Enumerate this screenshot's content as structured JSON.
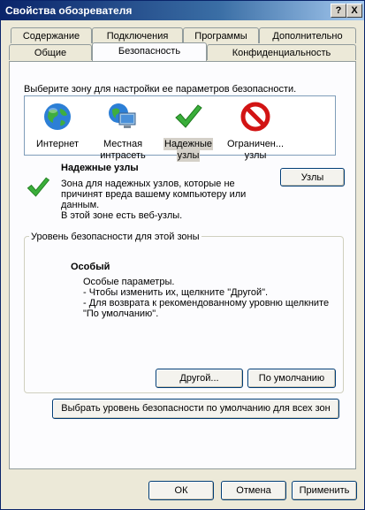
{
  "window": {
    "title": "Свойства обозревателя",
    "help_btn": "?",
    "close_btn": "X"
  },
  "tabs_row1": [
    {
      "label": "Содержание"
    },
    {
      "label": "Подключения"
    },
    {
      "label": "Программы"
    },
    {
      "label": "Дополнительно"
    }
  ],
  "tabs_row2": [
    {
      "label": "Общие"
    },
    {
      "label": "Безопасность",
      "selected": true
    },
    {
      "label": "Конфиденциальность"
    }
  ],
  "zones": {
    "prompt": "Выберите зону для настройки ее параметров безопасности.",
    "items": [
      {
        "label1": "Интернет",
        "label2": "",
        "icon": "globe-icon"
      },
      {
        "label1": "Местная",
        "label2": "интрасеть",
        "icon": "intranet-icon"
      },
      {
        "label1": "Надежные",
        "label2": "узлы",
        "icon": "checkmark-icon",
        "selected": true
      },
      {
        "label1": "Ограничен...",
        "label2": "узлы",
        "icon": "restricted-icon"
      }
    ]
  },
  "zone_info": {
    "title": "Надежные узлы",
    "desc1": "Зона для надежных узлов, которые не",
    "desc2": "причинят вреда вашему компьютеру или",
    "desc3": "данным.",
    "desc4": "В этой зоне есть веб-узлы.",
    "sites_btn": "Узлы"
  },
  "security_level": {
    "legend": "Уровень безопасности для этой зоны",
    "name": "Особый",
    "line1": "Особые параметры.",
    "line2": "- Чтобы изменить их, щелкните \"Другой\".",
    "line3": "- Для возврата к рекомендованному уровню щелкните",
    "line4": "\"По умолчанию\".",
    "custom_btn": "Другой...",
    "default_btn": "По умолчанию"
  },
  "reset_all_btn": "Выбрать уровень безопасности по умолчанию для всех зон",
  "footer": {
    "ok": "ОК",
    "cancel": "Отмена",
    "apply": "Применить"
  },
  "colors": {
    "titlebar": "#0a246a",
    "panel": "#fcfcfe",
    "dialog": "#ece9d8"
  }
}
